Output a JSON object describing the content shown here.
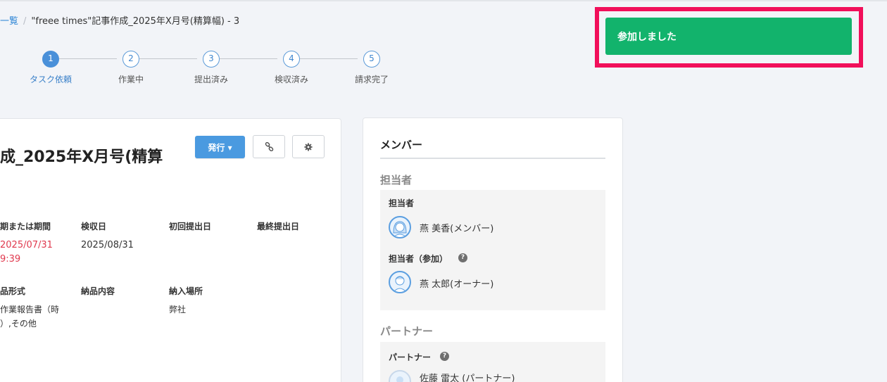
{
  "breadcrumb": {
    "parent_label": "一覧",
    "separator": "/",
    "current": "\"freee times\"記事作成_2025年X月号(精算幅) - 3"
  },
  "stepper": {
    "steps": [
      {
        "number": "1",
        "label": "タスク依頼",
        "active": true
      },
      {
        "number": "2",
        "label": "作業中",
        "active": false
      },
      {
        "number": "3",
        "label": "提出済み",
        "active": false
      },
      {
        "number": "4",
        "label": "検収済み",
        "active": false
      },
      {
        "number": "5",
        "label": "請求完了",
        "active": false
      }
    ]
  },
  "join_button": {
    "label": "参加しました",
    "color": "#12b36c",
    "highlight_color": "#f10f5a"
  },
  "task": {
    "title": "成_2025年X月号(精算",
    "issue_button": "発行 ▾",
    "fields": {
      "deadline": {
        "label": "期または期間",
        "value_line1": "2025/07/31",
        "value_line2": "9:39"
      },
      "inspection": {
        "label": "検収日",
        "value": "2025/08/31"
      },
      "first_submit": {
        "label": "初回提出日"
      },
      "last_submit": {
        "label": "最終提出日"
      },
      "format": {
        "label": "品形式",
        "value_line1": "作業報告書（時",
        "value_line2": "）,その他"
      },
      "content": {
        "label": "納品内容"
      },
      "place": {
        "label": "納入場所",
        "value": "弊社"
      }
    }
  },
  "members": {
    "title": "メンバー",
    "assignee_heading": "担当者",
    "assignee_label": "担当者",
    "assignee_name": "燕 美香(メンバー)",
    "participant_label": "担当者（参加）",
    "participant_name": "燕 太郎(オーナー)",
    "partner_heading": "パートナー",
    "partner_label": "パートナー",
    "partner_name": "佐藤 雷太 (パートナー)",
    "help_glyph": "?"
  },
  "icons": [
    "link-icon",
    "gear-icon",
    "help-icon",
    "avatar"
  ]
}
